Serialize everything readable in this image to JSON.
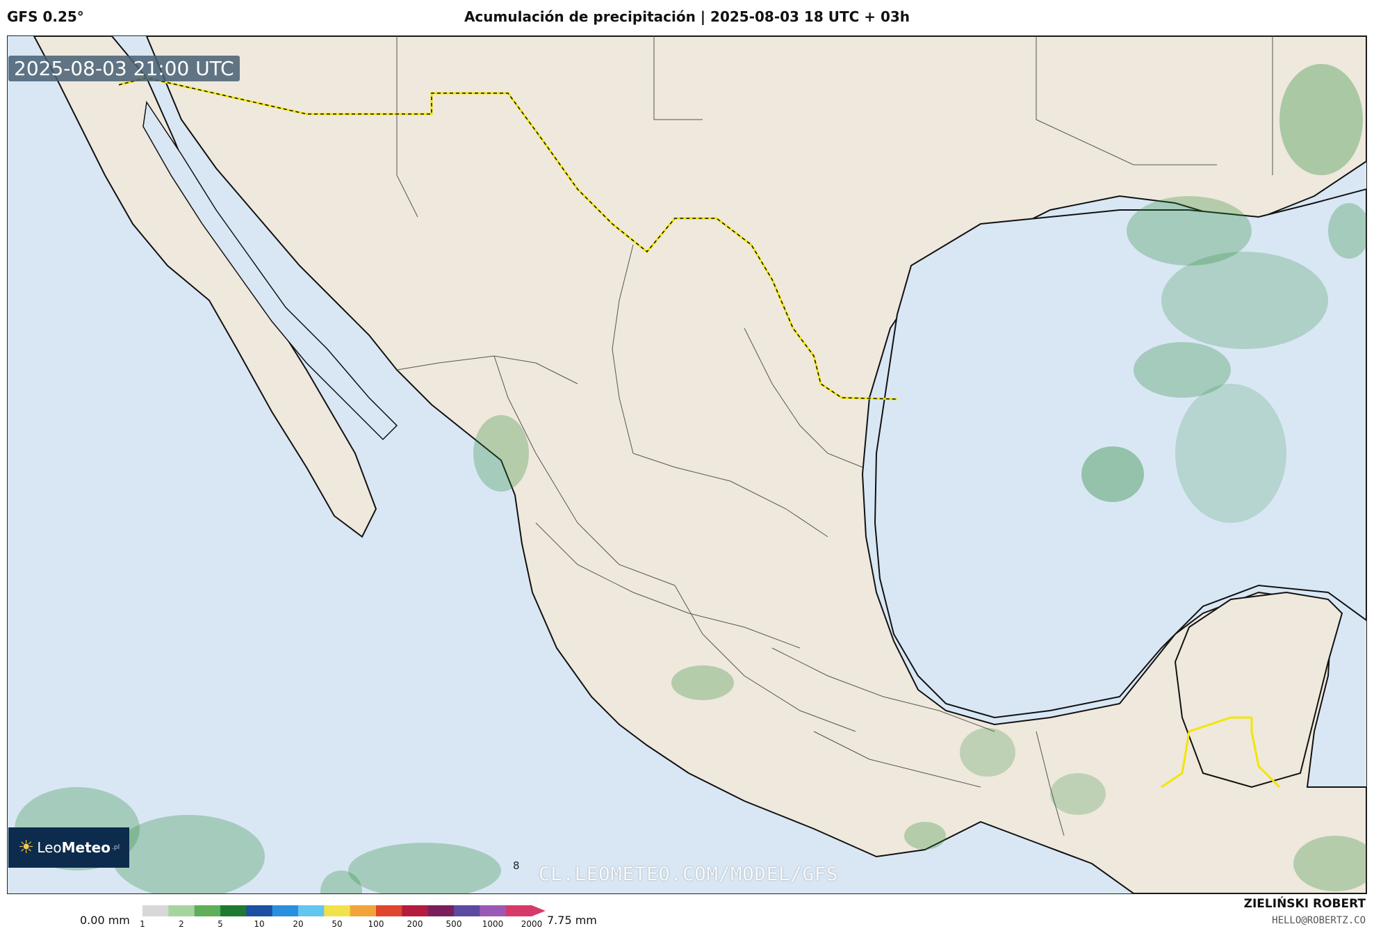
{
  "header": {
    "model": "GFS 0.25°",
    "title": "Acumulación de precipitación | 2025-08-03 18 UTC + 03h"
  },
  "map": {
    "timestamp": "2025-08-03 21:00 UTC",
    "watermark": "CL.LEOMETEO.COM/MODEL/GFS",
    "cell_value": "8",
    "colors": {
      "ocean": "#d9e7f5",
      "land": "#efe8dc",
      "border": "#f2e600",
      "precip": "#2e8b3c"
    }
  },
  "logo": {
    "prefix": "Leo",
    "bold": "Meteo",
    "suffix": ".pl"
  },
  "colorbar": {
    "min_label": "0.00 mm",
    "max_label": "7.75 mm",
    "ticks": [
      "1",
      "2",
      "5",
      "10",
      "20",
      "50",
      "100",
      "200",
      "500",
      "1000",
      "2000"
    ],
    "colors": [
      "#d8d8d8",
      "#a6d49f",
      "#5fae5a",
      "#1e7a2e",
      "#1d4fa3",
      "#2b8fe0",
      "#63c5f0",
      "#f2e24a",
      "#f2a43a",
      "#e0452e",
      "#b41b3c",
      "#7a1f5c",
      "#5b4aa0",
      "#9b59b6",
      "#d63a6a"
    ]
  },
  "footer": {
    "author": "ZIELIŃSKI ROBERT",
    "email": "HELLO@ROBERTZ.CO"
  }
}
